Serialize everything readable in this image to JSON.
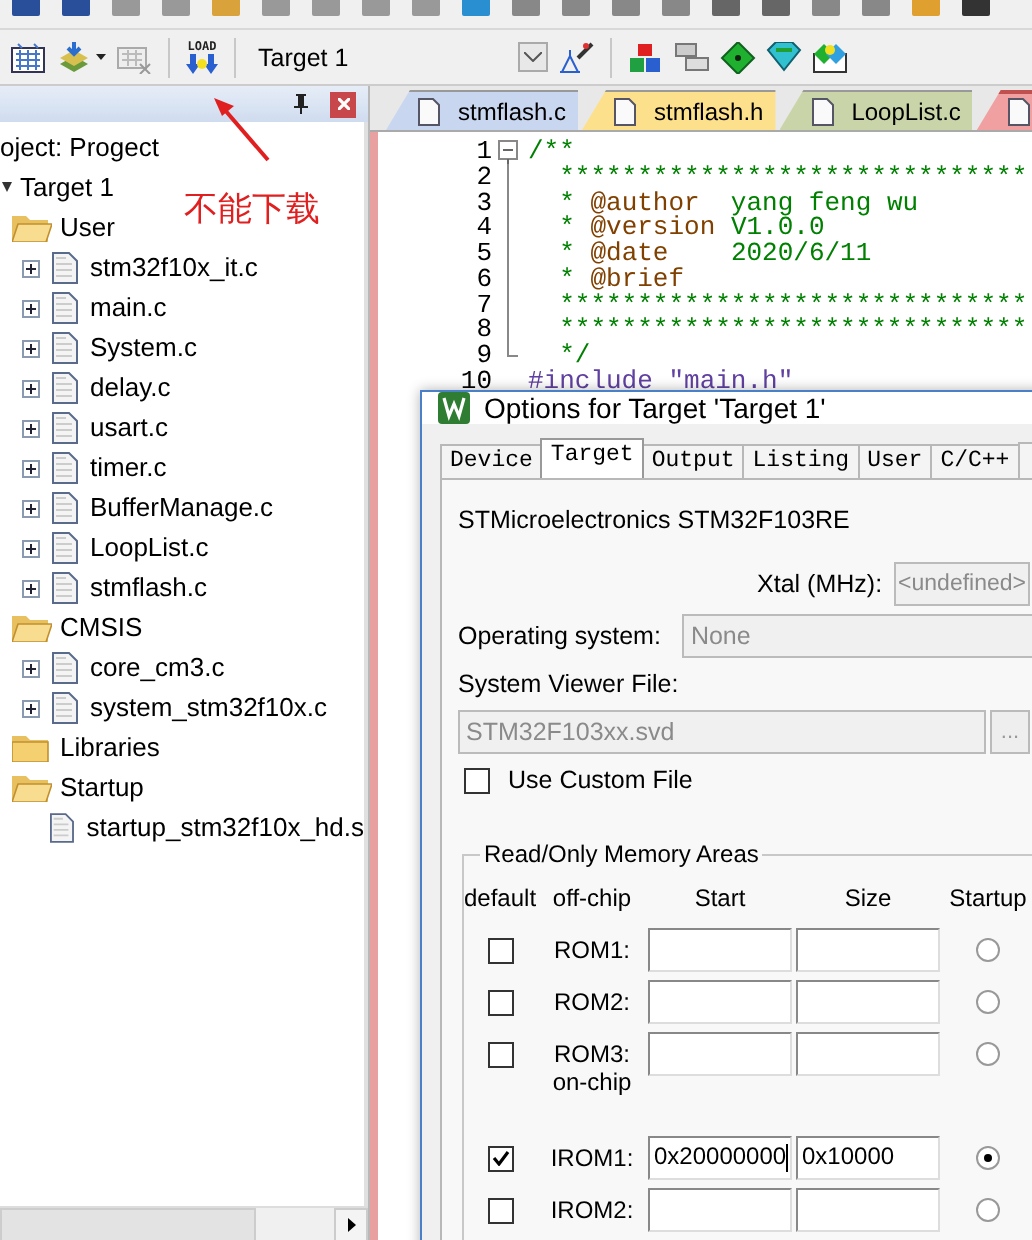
{
  "toolbar": {
    "load_label": "LOAD",
    "target": "Target 1"
  },
  "project_panel": {
    "title": "oject: Progect",
    "children": [
      {
        "name": "Target 1",
        "expanded": true,
        "children": [
          {
            "name": "User",
            "kind": "folder",
            "expanded": true,
            "children": [
              {
                "name": "stm32f10x_it.c",
                "kind": "file",
                "expandable": true
              },
              {
                "name": "main.c",
                "kind": "file",
                "expandable": true
              },
              {
                "name": "System.c",
                "kind": "file",
                "expandable": true
              },
              {
                "name": "delay.c",
                "kind": "file",
                "expandable": true
              },
              {
                "name": "usart.c",
                "kind": "file",
                "expandable": true
              },
              {
                "name": "timer.c",
                "kind": "file",
                "expandable": true
              },
              {
                "name": "BufferManage.c",
                "kind": "file",
                "expandable": true
              },
              {
                "name": "LoopList.c",
                "kind": "file",
                "expandable": true
              },
              {
                "name": "stmflash.c",
                "kind": "file",
                "expandable": true
              }
            ]
          },
          {
            "name": "CMSIS",
            "kind": "folder",
            "expanded": true,
            "children": [
              {
                "name": "core_cm3.c",
                "kind": "file",
                "expandable": true
              },
              {
                "name": "system_stm32f10x.c",
                "kind": "file",
                "expandable": true
              }
            ]
          },
          {
            "name": "Libraries",
            "kind": "folder",
            "expanded": false
          },
          {
            "name": "Startup",
            "kind": "folder",
            "expanded": true,
            "children": [
              {
                "name": "startup_stm32f10x_hd.s",
                "kind": "file",
                "expandable": false
              }
            ]
          }
        ]
      }
    ]
  },
  "annotation": {
    "text": "不能下载"
  },
  "editor": {
    "tabs": [
      {
        "label": "stmflash.c",
        "color": "#c9d6ef",
        "selected": false
      },
      {
        "label": "stmflash.h",
        "color": "#fde08c",
        "selected": false
      },
      {
        "label": "LoopList.c",
        "color": "#c9d5a9",
        "selected": false
      },
      {
        "color": "#f0a0a0",
        "selected": true
      }
    ],
    "lines": [
      {
        "number": "1",
        "fold_expanded": true,
        "parts": [
          {
            "text": "/**",
            "kind": "comment"
          }
        ]
      },
      {
        "number": "2",
        "parts": [
          {
            "text": "  ******************************",
            "kind": "comment"
          }
        ]
      },
      {
        "number": "3",
        "parts": [
          {
            "text": "  * ",
            "kind": "comment"
          },
          {
            "text": "@author",
            "kind": "tag"
          },
          {
            "text": "  yang feng wu",
            "kind": "comment"
          }
        ]
      },
      {
        "number": "4",
        "parts": [
          {
            "text": "  * ",
            "kind": "comment"
          },
          {
            "text": "@version",
            "kind": "tag"
          },
          {
            "text": " V1.0.0",
            "kind": "comment"
          }
        ]
      },
      {
        "number": "5",
        "parts": [
          {
            "text": "  * ",
            "kind": "comment"
          },
          {
            "text": "@date",
            "kind": "tag"
          },
          {
            "text": "    2020/6/11",
            "kind": "comment"
          }
        ]
      },
      {
        "number": "6",
        "parts": [
          {
            "text": "  * ",
            "kind": "comment"
          },
          {
            "text": "@brief",
            "kind": "tag"
          }
        ]
      },
      {
        "number": "7",
        "parts": [
          {
            "text": "  ******************************",
            "kind": "comment"
          }
        ]
      },
      {
        "number": "8",
        "parts": [
          {
            "text": "  ******************************",
            "kind": "comment"
          }
        ]
      },
      {
        "number": "9",
        "fold_end": true,
        "parts": [
          {
            "text": "  */",
            "kind": "comment"
          }
        ]
      },
      {
        "number": "10",
        "parts": [
          {
            "text": "#include \"main.h\"",
            "kind": "directive"
          }
        ]
      }
    ]
  },
  "dialog": {
    "title": "Options for Target 'Target 1'",
    "tabs": [
      {
        "label": "Device",
        "selected": false
      },
      {
        "label": "Target",
        "selected": true
      },
      {
        "label": "Output",
        "selected": false
      },
      {
        "label": "Listing",
        "selected": false
      },
      {
        "label": "User",
        "selected": false
      },
      {
        "label": "C/C++",
        "selected": false
      }
    ],
    "device": "STMicroelectronics STM32F103RE",
    "xtal": {
      "label": "Xtal (MHz):",
      "value": "<undefined>",
      "disabled": true
    },
    "os": {
      "label": "Operating system:",
      "value": "None",
      "disabled": true
    },
    "svd": {
      "label": "System Viewer File:",
      "value": "STM32F103xx.svd",
      "disabled": true,
      "browse": "..."
    },
    "custom_file": {
      "label": "Use Custom File",
      "checked": false
    },
    "memory": {
      "title": "Read/Only Memory Areas",
      "headers": [
        "default",
        "off-chip",
        "Start",
        "Size",
        "Startup"
      ],
      "rows": [
        {
          "kind": "region",
          "label": "ROM1:",
          "checked": false,
          "startup_selected": false
        },
        {
          "kind": "region",
          "label": "ROM2:",
          "checked": false,
          "startup_selected": false
        },
        {
          "kind": "region",
          "label": "ROM3:",
          "checked": false,
          "startup_selected": false
        },
        {
          "kind": "section",
          "label": "on-chip"
        },
        {
          "kind": "region",
          "label": "IROM1:",
          "checked": true,
          "start": "0x20000000",
          "size": "0x10000",
          "startup_selected": true
        },
        {
          "kind": "region",
          "label": "IROM2:",
          "checked": false,
          "startup_selected": false
        }
      ]
    }
  }
}
